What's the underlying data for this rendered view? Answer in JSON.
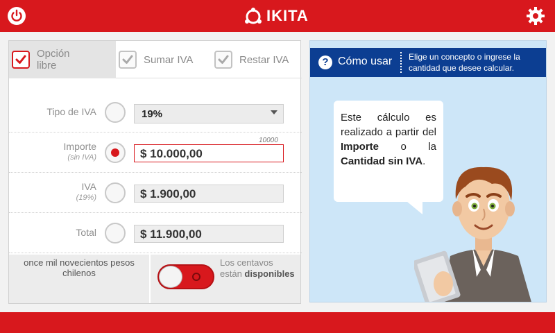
{
  "app": {
    "brand": "IKITA"
  },
  "topbar": {
    "power_icon": "power-icon",
    "settings_icon": "gear-icon"
  },
  "options": [
    {
      "label": "Opción libre",
      "checked": true
    },
    {
      "label": "Sumar IVA",
      "checked": true
    },
    {
      "label": "Restar IVA",
      "checked": true
    }
  ],
  "form": {
    "tipo_iva": {
      "label": "Tipo de IVA",
      "value": "19%"
    },
    "importe": {
      "label": "Importe",
      "sublabel": "(sin IVA)",
      "value": "$ 10.000,00",
      "hint": "10000"
    },
    "iva": {
      "label": "IVA",
      "sublabel": "(19%)",
      "value": "$ 1.900,00"
    },
    "total": {
      "label": "Total",
      "value": "$ 11.900,00"
    },
    "amount_words": "once mil novecientos pesos chilenos",
    "centavos_text_a": "Los centavos están ",
    "centavos_text_b": "disponibles"
  },
  "help": {
    "title": "Cómo usar",
    "description": "Elige un concepto o ingrese la cantidad que desee calcular.",
    "bubble_a": "Este cálculo es realizado a partir del ",
    "bubble_b": "Importe",
    "bubble_c": " o la ",
    "bubble_d": "Cantidad sin IVA",
    "bubble_e": "."
  },
  "colors": {
    "brand_red": "#d8181d",
    "help_blue": "#0c3e92",
    "help_bg": "#cde6f8"
  }
}
